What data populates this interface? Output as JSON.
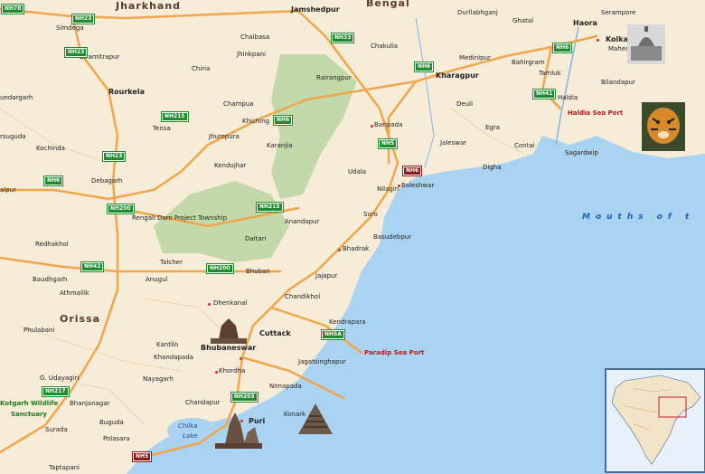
{
  "map": {
    "states": [
      "Jharkhand",
      "Bengal",
      "Orissa"
    ],
    "sea": "Mouths of t",
    "cities_bold": [
      "Jamshedpur",
      "Kolkata",
      "Kharagpur",
      "Rourkela",
      "Cuttack",
      "Bhubaneswar",
      "Puri",
      "Haora"
    ],
    "places": [
      "Simdega",
      "Biramitrapur",
      "Chiria",
      "Chaibasa",
      "Jhinkpani",
      "Rairangpur",
      "Chakulia",
      "Durllabhganj",
      "Ghatal",
      "Serampore",
      "Maheshtala",
      "Medinipur",
      "Bahirgram",
      "Tamluk",
      "Bilandapur",
      "Haldia",
      "Baripada",
      "Deuli",
      "Egra",
      "Contai",
      "Jaleswar",
      "Digha",
      "Sagardwip",
      "Udala",
      "Nilagiri",
      "Baleshwar",
      "Soro",
      "Basudebpur",
      "Bhadrak",
      "Anandapur",
      "Daitari",
      "Jajapur",
      "Bhuban",
      "Chandikhol",
      "Kendrapara",
      "Dhenkanal",
      "Talcher",
      "Anugul",
      "Jagatsinghapur",
      "Khordha",
      "Nimapada",
      "Konark",
      "Chandapur",
      "Kantilo",
      "Khandapada",
      "Nayagarh",
      "Buguda",
      "Polasara",
      "Surada",
      "Taptapani",
      "Bhanjanagar",
      "G. Udayagiri",
      "Phulabani",
      "Athmallik",
      "Baudhgarh",
      "Redhakhol",
      "Debagarh",
      "Kochinda",
      "Tensa",
      "Jhumpura",
      "Champua",
      "Khiching",
      "Karanjia",
      "Kendujhar",
      "Rengali Dam Project Township",
      "undargarh",
      "rsuguda",
      "alpur"
    ],
    "ports": [
      "Haldia Sea Port",
      "Paradip Sea Port"
    ],
    "parks": [
      "Kotgarh Wildlife",
      "Sanctuary"
    ],
    "lake": [
      "Chilka",
      "Lake"
    ],
    "highways": [
      "NH78",
      "NH23",
      "NH23",
      "NH33",
      "NH6",
      "NH6",
      "NH215",
      "NH6",
      "NH5",
      "NH6",
      "NH23",
      "NH6",
      "NH200",
      "NH215",
      "NH42",
      "NH200",
      "NH41",
      "NH5A",
      "NH217",
      "NH203",
      "NH5"
    ]
  },
  "colors": {
    "land": "#f6ecd8",
    "sea": "#a9d3f1",
    "forest": "#c3d9a9",
    "highway": "#f0a64a",
    "shield": "#1f8a2e"
  }
}
